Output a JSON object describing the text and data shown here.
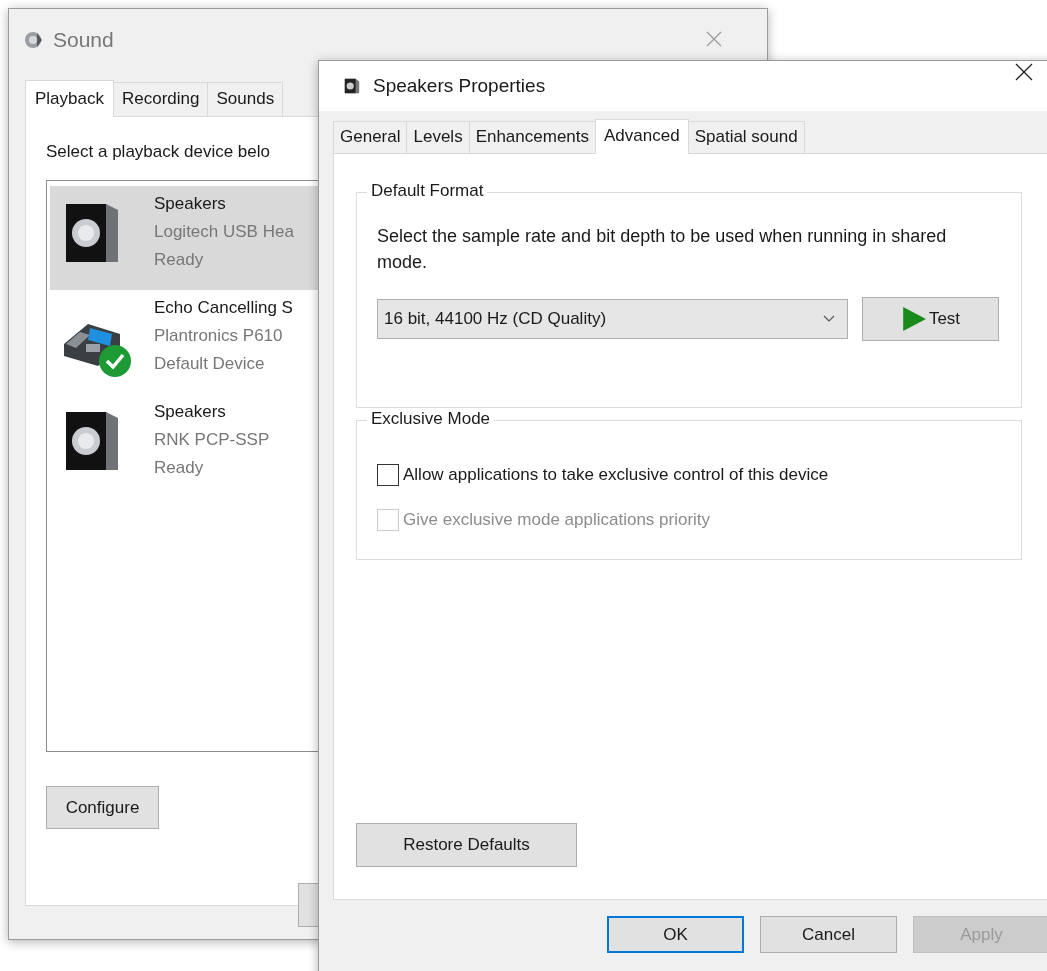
{
  "sound_window": {
    "title": "Sound",
    "tabs": [
      {
        "label": "Playback",
        "selected": true
      },
      {
        "label": "Recording",
        "selected": false
      },
      {
        "label": "Sounds",
        "selected": false
      }
    ],
    "instruction": "Select a playback device belo",
    "devices": [
      {
        "kind": "speaker",
        "name": "Speakers",
        "description": "Logitech USB Hea",
        "status": "Ready",
        "selected": true,
        "is_default": false
      },
      {
        "kind": "phone",
        "name": "Echo Cancelling S",
        "description": "Plantronics P610",
        "status": "Default Device",
        "selected": false,
        "is_default": true
      },
      {
        "kind": "speaker",
        "name": "Speakers",
        "description": "RNK PCP-SSP",
        "status": "Ready",
        "selected": false,
        "is_default": false
      }
    ],
    "configure_button": "Configure"
  },
  "properties_window": {
    "title": "Speakers Properties",
    "tabs": [
      {
        "label": "General",
        "selected": false
      },
      {
        "label": "Levels",
        "selected": false
      },
      {
        "label": "Enhancements",
        "selected": false
      },
      {
        "label": "Advanced",
        "selected": true
      },
      {
        "label": "Spatial sound",
        "selected": false
      }
    ],
    "default_format": {
      "heading": "Default Format",
      "description": "Select the sample rate and bit depth to be used when running in shared mode.",
      "format": "16 bit, 44100 Hz (CD Quality)",
      "test_button": "Test"
    },
    "exclusive_mode": {
      "heading": "Exclusive Mode",
      "options": [
        {
          "label": "Allow applications to take exclusive control of this device",
          "checked": false,
          "disabled": false
        },
        {
          "label": "Give exclusive mode applications priority",
          "checked": false,
          "disabled": true
        }
      ]
    },
    "restore_button": "Restore Defaults",
    "buttons": [
      {
        "label": "OK",
        "focused": true,
        "disabled": false
      },
      {
        "label": "Cancel",
        "focused": false,
        "disabled": false
      },
      {
        "label": "Apply",
        "focused": false,
        "disabled": true
      }
    ]
  }
}
